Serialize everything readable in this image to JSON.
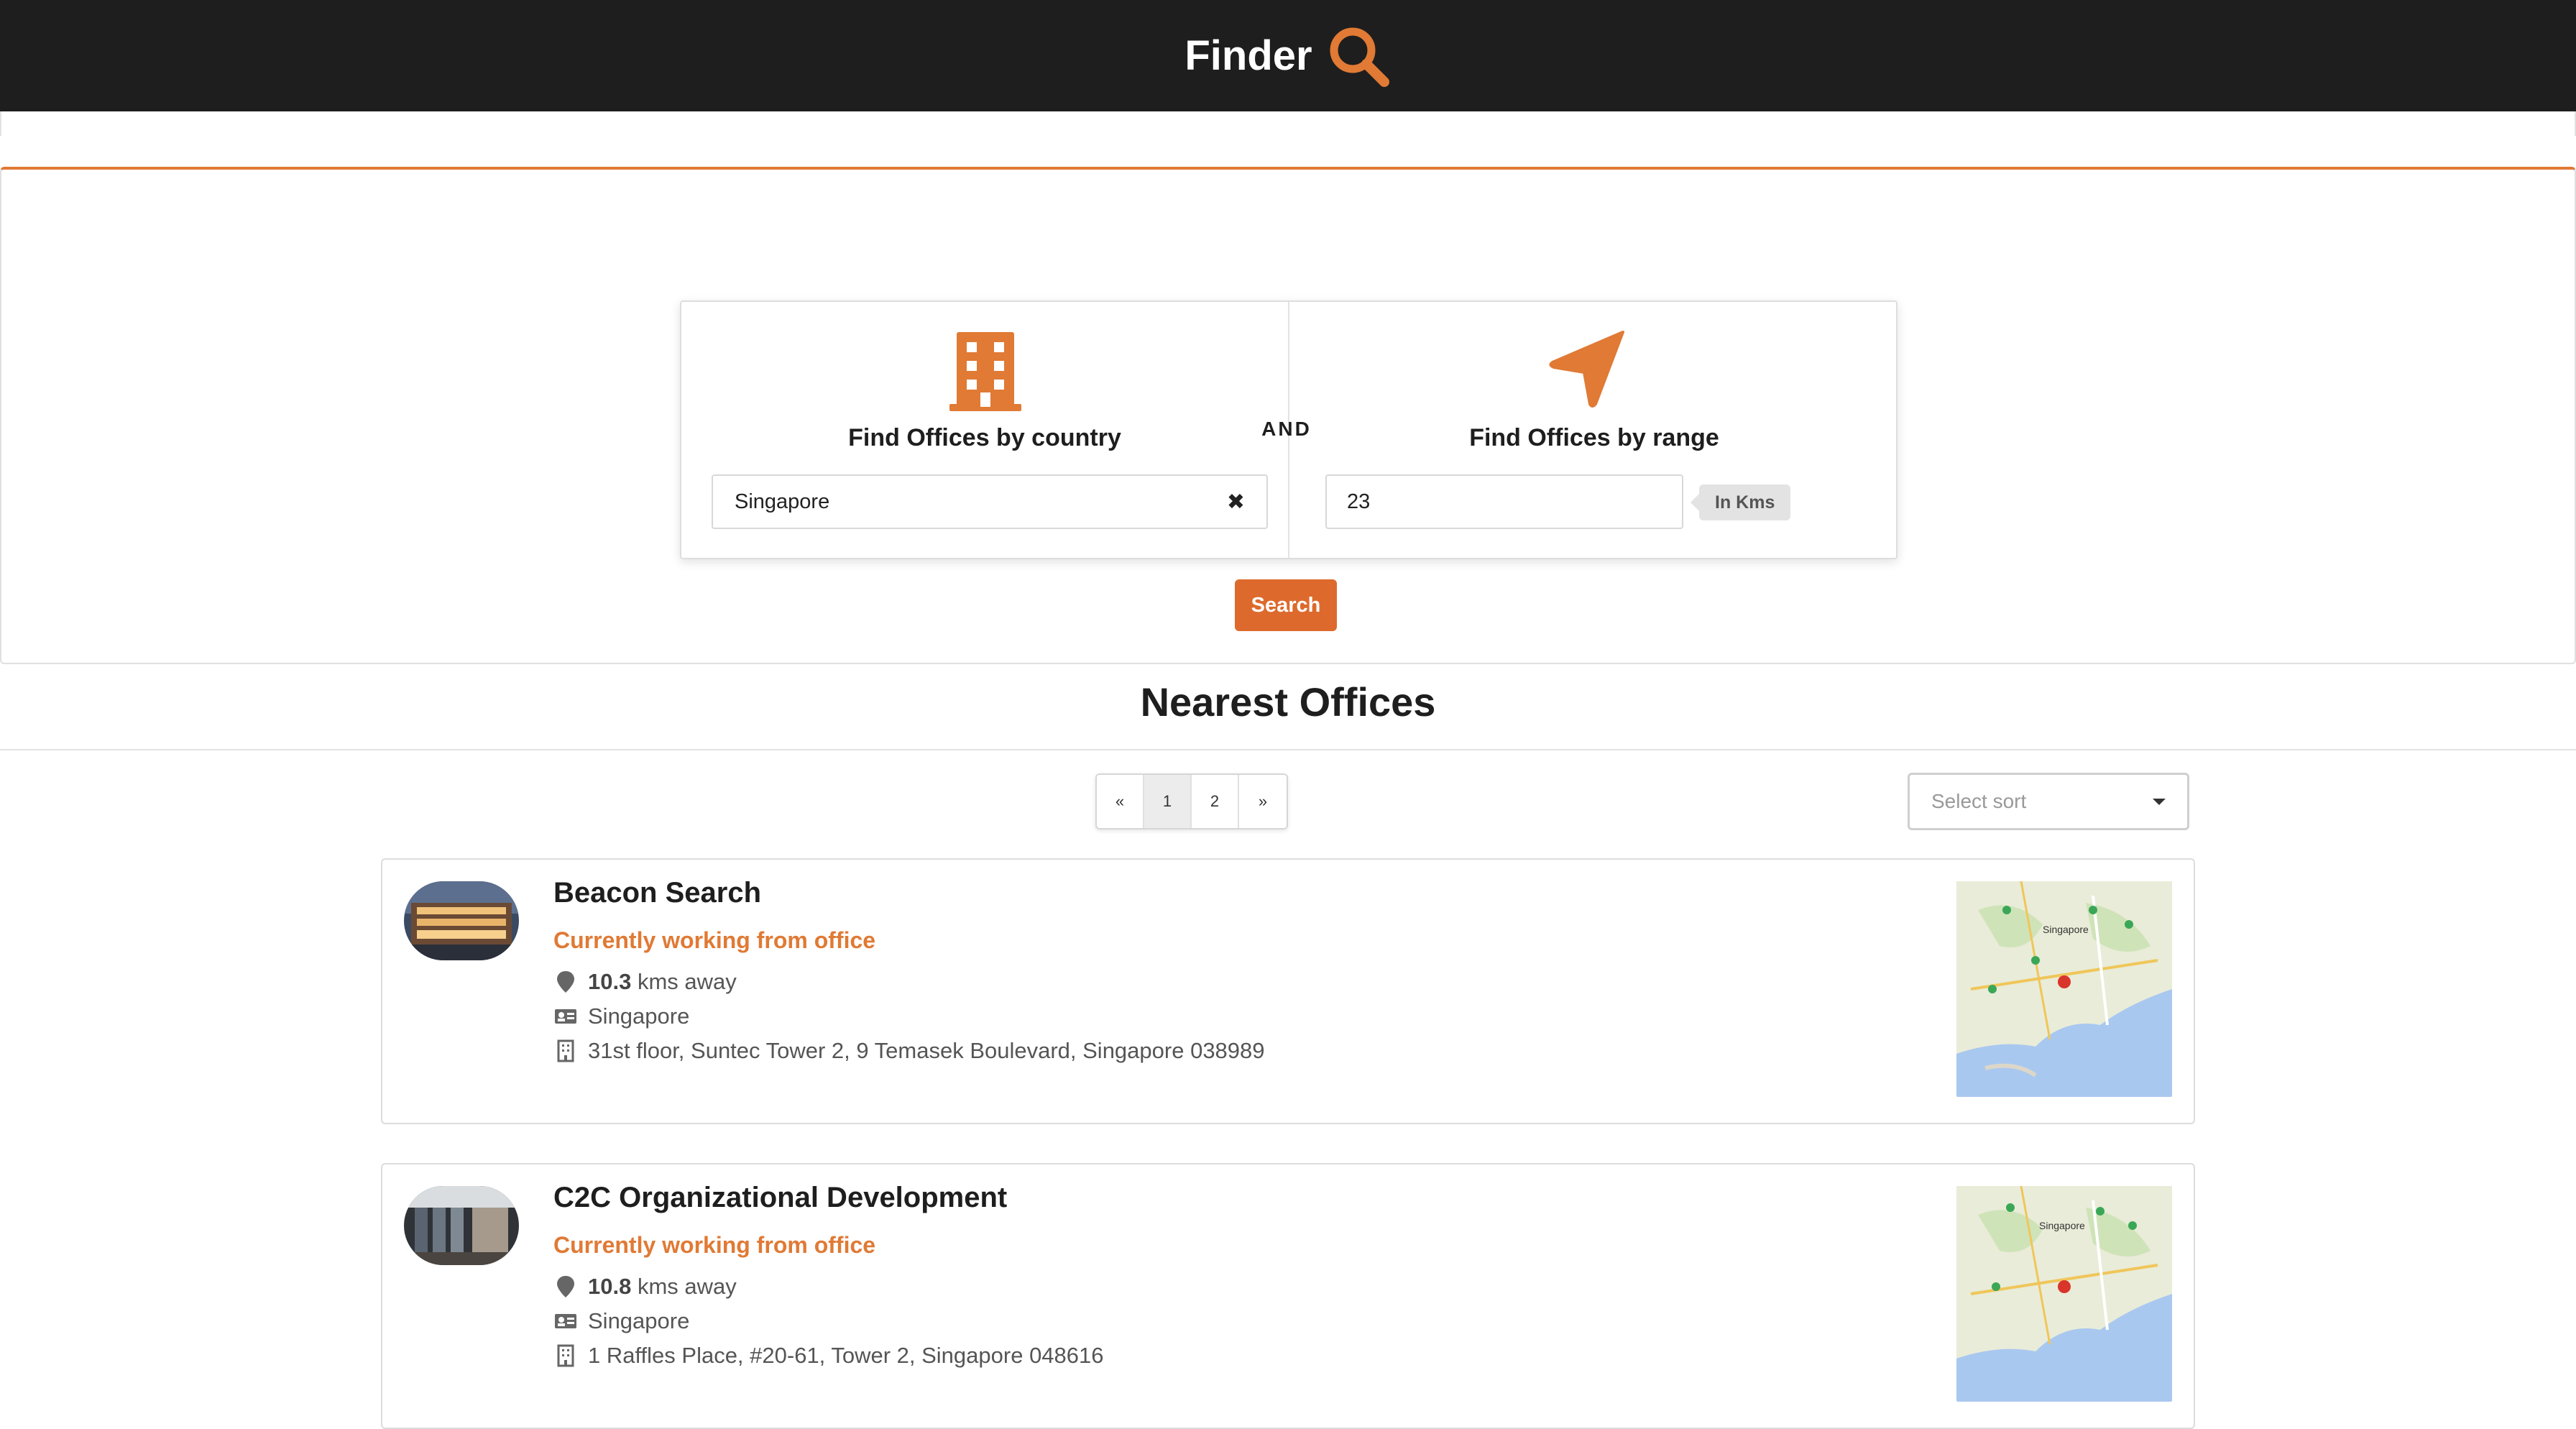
{
  "header": {
    "brand": "Finder",
    "search_icon": "magnifier-icon"
  },
  "search": {
    "country_title": "Find Offices by country",
    "country_icon": "building-icon",
    "country_value": "Singapore",
    "clear_icon": "clear-x-icon",
    "conjunction": "AND",
    "range_title": "Find Offices by range",
    "range_icon": "navigation-arrow-icon",
    "range_value": "23",
    "range_unit": "In Kms",
    "button_label": "Search",
    "accent_color": "#e07a35"
  },
  "results": {
    "title": "Nearest Offices",
    "pagination": [
      "«",
      "1",
      "2",
      "»"
    ],
    "active_page": "1",
    "sort_placeholder": "Select sort",
    "offices": [
      {
        "name": "Beacon Search",
        "status": "Currently working from office",
        "distance": "10.3",
        "distance_suffix": "kms away",
        "country": "Singapore",
        "address": "31st floor, Suntec Tower 2, 9 Temasek Boulevard, Singapore 038989"
      },
      {
        "name": "C2C Organizational Development",
        "status": "Currently working from office",
        "distance": "10.8",
        "distance_suffix": "kms away",
        "country": "Singapore",
        "address": "1 Raffles Place, #20-61, Tower 2, Singapore 048616"
      }
    ],
    "map_label": "Singapore"
  }
}
